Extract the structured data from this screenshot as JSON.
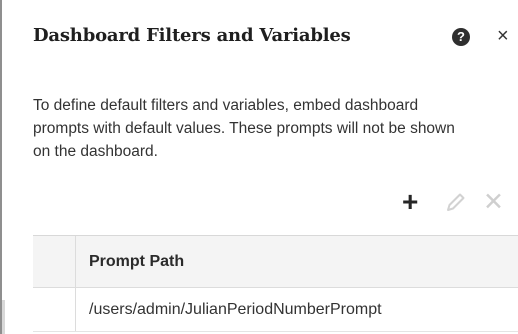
{
  "dialog": {
    "title": "Dashboard Filters and Variables",
    "help_icon": "question-circle-icon",
    "help_glyph": "?",
    "close_icon": "close-icon",
    "close_glyph": "×",
    "description": "To define default filters and variables, embed dashboard prompts with default values. These prompts will not be shown on the dashboard."
  },
  "toolbar": {
    "add_icon": "plus-icon",
    "add_glyph": "+",
    "edit_icon": "pencil-icon",
    "delete_icon": "delete-x-icon",
    "delete_glyph": "✕"
  },
  "table": {
    "columns": [
      "",
      "Prompt Path"
    ],
    "rows": [
      {
        "prompt_path": "/users/admin/JulianPeriodNumberPrompt"
      }
    ]
  },
  "colors": {
    "header_bg": "#f4f4f4",
    "disabled_icon": "#cfcfcf",
    "text": "#333333"
  }
}
